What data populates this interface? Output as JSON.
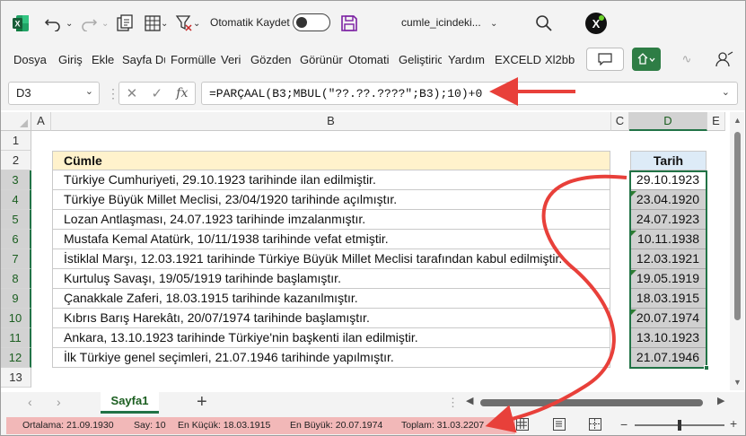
{
  "titlebar": {
    "autosave_label": "Otomatik Kaydet",
    "filename": "cumle_icindeki...",
    "app_icon": "excel-logo",
    "addin_letter": "X"
  },
  "ribbon": {
    "tabs": [
      "Dosya",
      "Giriş",
      "Ekle",
      "Sayfa Dü",
      "Formülle",
      "Veri",
      "Gözden",
      "Görünür",
      "Otomati",
      "Geliştiric",
      "Yardım",
      "EXCELD",
      "Xl2bb"
    ]
  },
  "formula_bar": {
    "name_box": "D3",
    "formula": "=PARÇAAL(B3;MBUL(\"??.??.????\";B3);10)+0",
    "fx_label": "fx"
  },
  "columns": [
    "A",
    "B",
    "C",
    "D",
    "E"
  ],
  "rows": [
    "1",
    "2",
    "3",
    "4",
    "5",
    "6",
    "7",
    "8",
    "9",
    "10",
    "11",
    "12",
    "13"
  ],
  "table": {
    "header_b": "Cümle",
    "header_d": "Tarih",
    "sentences": [
      "Türkiye Cumhuriyeti, 29.10.1923 tarihinde ilan edilmiştir.",
      "Türkiye Büyük Millet Meclisi, 23/04/1920 tarihinde açılmıştır.",
      "Lozan Antlaşması, 24.07.1923 tarihinde imzalanmıştır.",
      "Mustafa Kemal Atatürk, 10/11/1938 tarihinde vefat etmiştir.",
      "İstiklal Marşı, 12.03.1921 tarihinde Türkiye Büyük Millet Meclisi tarafından kabul edilmiştir.",
      "Kurtuluş Savaşı, 19/05/1919 tarihinde başlamıştır.",
      "Çanakkale Zaferi, 18.03.1915 tarihinde kazanılmıştır.",
      "Kıbrıs Barış Harekâtı, 20/07/1974 tarihinde başlamıştır.",
      "Ankara, 13.10.1923 tarihinde Türkiye'nin başkenti ilan edilmiştir.",
      "İlk Türkiye genel seçimleri, 21.07.1946 tarihinde yapılmıştır."
    ],
    "dates": [
      "29.10.1923",
      "23.04.1920",
      "24.07.1923",
      "10.11.1938",
      "12.03.1921",
      "19.05.1919",
      "18.03.1915",
      "20.07.1974",
      "13.10.1923",
      "21.07.1946"
    ]
  },
  "sheets": {
    "active": "Sayfa1",
    "add_label": "+"
  },
  "status": {
    "average": "Ortalama: 21.09.1930",
    "count": "Say: 10",
    "min": "En Küçük: 18.03.1915",
    "max": "En Büyük: 20.07.1974",
    "sum": "Toplam: 31.03.2207"
  },
  "colors": {
    "accent_green": "#217346",
    "header_yellow": "#fff2cc",
    "header_blue": "#ddebf7",
    "arrow_red": "#e8403a",
    "status_highlight": "#f2b8b8"
  }
}
